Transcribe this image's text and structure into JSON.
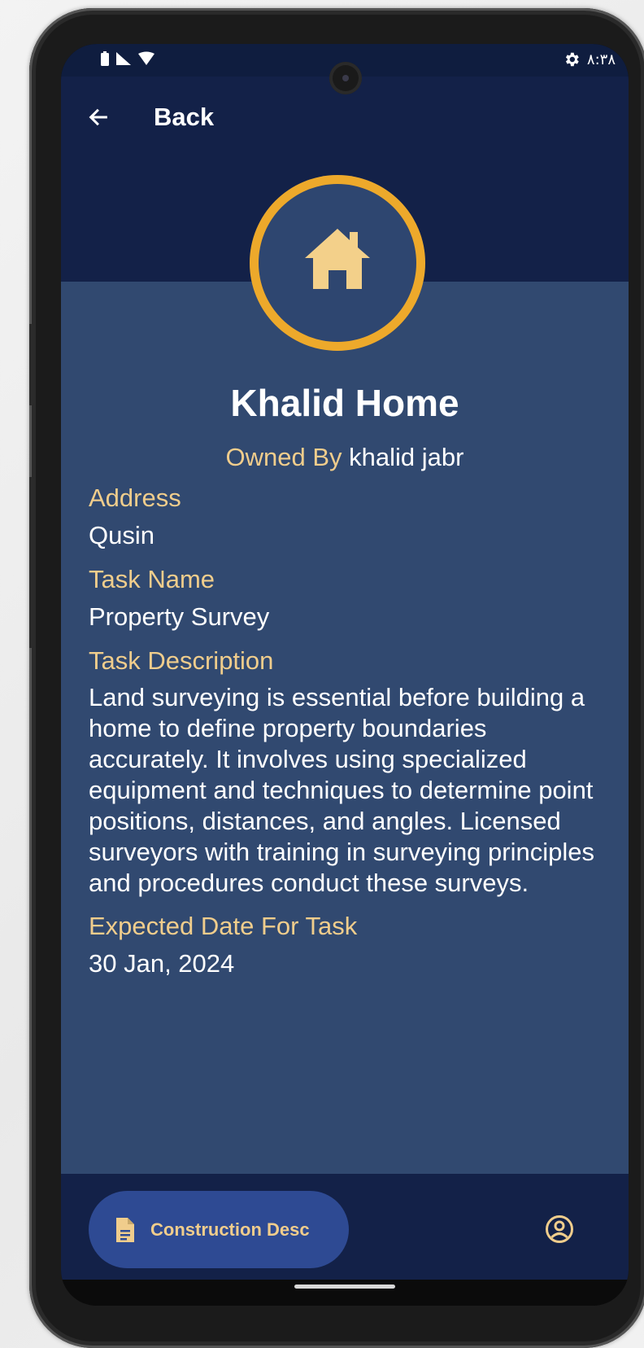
{
  "status_bar": {
    "time": "٨:٣٨",
    "icons": [
      "battery-icon",
      "signal-icon",
      "wifi-icon",
      "settings-icon"
    ]
  },
  "header": {
    "back_label": "Back",
    "back_icon": "arrow-left-icon"
  },
  "property": {
    "icon": "house-icon",
    "title": "Khalid Home",
    "owned_by_label": "Owned By",
    "owner_name": "khalid jabr"
  },
  "details": {
    "address_label": "Address",
    "address_value": "Qusin",
    "task_name_label": "Task Name",
    "task_name_value": "Property Survey",
    "task_description_label": "Task Description",
    "task_description_value": "Land surveying is essential before building a home to define property boundaries accurately. It involves using specialized equipment and techniques to determine point positions, distances, and angles. Licensed surveyors with training in surveying principles and procedures conduct these surveys.",
    "expected_date_label": "Expected Date For Task",
    "expected_date_value": "30 Jan, 2024"
  },
  "bottom_nav": {
    "active_label": "Construction Desc",
    "active_icon": "document-icon",
    "profile_icon": "account-circle-icon"
  },
  "colors": {
    "header_bg": "#132148",
    "main_bg": "#314970",
    "accent": "#eda92b",
    "label_color": "#f0cd8c",
    "pill_bg": "#2e4a93"
  }
}
